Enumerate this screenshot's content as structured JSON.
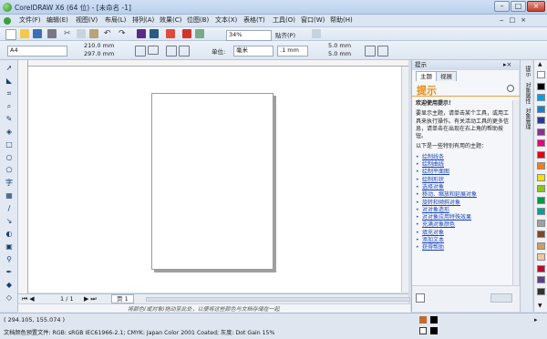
{
  "window": {
    "title": "CorelDRAW X6 (64 位) - [未命名 -1]"
  },
  "menu": [
    "文件(F)",
    "编辑(E)",
    "视图(V)",
    "布局(L)",
    "排列(A)",
    "效果(C)",
    "位图(B)",
    "文本(X)",
    "表格(T)",
    "工具(O)",
    "窗口(W)",
    "帮助(H)"
  ],
  "toolbar": {
    "zoom": "34%",
    "snap": "贴齐(P)"
  },
  "property_bar": {
    "paper": "A4",
    "width": "210.0 mm",
    "height": "297.0 mm",
    "units_label": "单位:",
    "units": "毫米",
    "nudge": ".1 mm",
    "dup_x": "5.0 mm",
    "dup_y": "5.0 mm"
  },
  "page_nav": {
    "counter": "1 / 1",
    "page_tab": "页 1"
  },
  "palette_hint": "将颜色(或对象)拖动至此处，以便将这些颜色与文档存储在一起",
  "docker": {
    "title": "提示",
    "tabs": [
      "主题",
      "视展"
    ],
    "heading": "提示",
    "welcome": "欢迎使用提示！",
    "intro": "要显示主题，请单击某个工具，或用工具来执行操作。有关活动工具的更多信息，请单击在出现在右上角的帮助按钮。",
    "subhead": "以下是一些特别有用的主题：",
    "links": [
      "绘制线条",
      "绘制曲线",
      "绘制平面图",
      "绘制形状",
      "选择对象",
      "移动、缩放和延展对象",
      "旋转和倾斜对象",
      "对对象造形",
      "对对象应用特殊效果",
      "充满对象颜色",
      "填充对象",
      "添加文本",
      "获得帮助"
    ]
  },
  "side_tabs": [
    "提示",
    "对象属性",
    "对象管理"
  ],
  "palette_colors": [
    "#ffffff",
    "#000000",
    "#00a0e9",
    "#1e7fc1",
    "#2a3a92",
    "#8f2f8f",
    "#e4007f",
    "#e60012",
    "#ef7f1a",
    "#f5e100",
    "#8fc31f",
    "#009944",
    "#00a29a",
    "#a0a0a0",
    "#7c4a2a",
    "#c8a063",
    "#f0c8a0",
    "#b50e2c",
    "#5f3f8f",
    "#333333"
  ],
  "status": {
    "coords": "( 294.105, 155.074 )",
    "doc": "文档颜色预置文件: RGB: sRGB IEC61966-2.1; CMYK: Japan Color 2001 Coated; 灰度: Dot Gain 15%"
  }
}
